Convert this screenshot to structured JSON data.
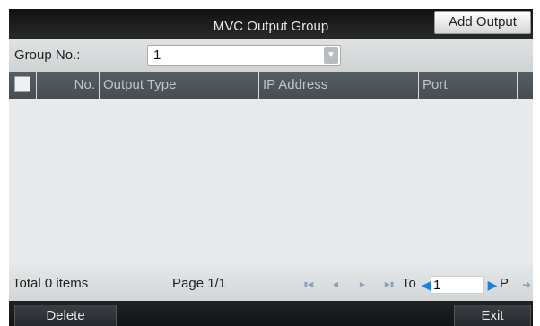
{
  "window": {
    "title": "MVC Output Group",
    "add_output_label": "Add Output"
  },
  "group": {
    "label": "Group No.:",
    "selected_value": "1"
  },
  "table": {
    "columns": [
      "No.",
      "Output Type",
      "IP Address",
      "Port"
    ],
    "rows": []
  },
  "pager": {
    "total": "Total 0 items",
    "page": "Page 1/1",
    "to_label": "To",
    "page_input_value": "1",
    "p_label": "P"
  },
  "footer": {
    "delete_label": "Delete",
    "exit_label": "Exit"
  },
  "icons": {
    "first_page": "first-page-icon",
    "prev_page": "prev-page-icon",
    "next_page": "next-page-icon",
    "last_page": "last-page-icon",
    "go": "arrow-right-icon",
    "dropdown": "chevron-down-icon"
  },
  "colors": {
    "title_bar": "#1a1a1a",
    "header_row": "#4f565c",
    "table_body": "#e7eaeb",
    "pager_bar": "#dcdfe0",
    "spinner_arrow": "#1c7fd8"
  }
}
